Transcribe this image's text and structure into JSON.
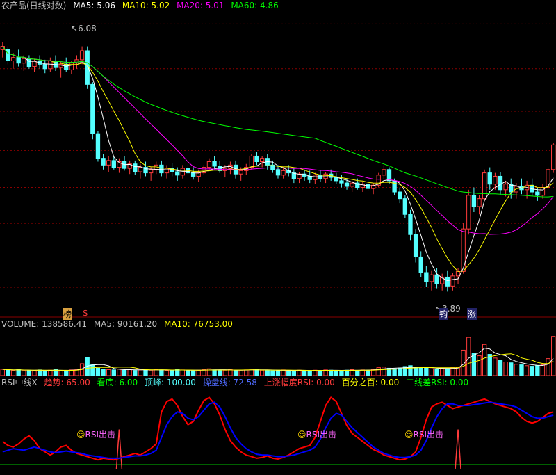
{
  "header": {
    "title": "农产品(日线对数)",
    "ma5": "MA5: 5.06",
    "ma10": "MA10: 5.02",
    "ma20": "MA20: 5.01",
    "ma60": "MA60: 4.86"
  },
  "volume_header": {
    "label": "VOLUME: 138586.41",
    "ma5": "MA5: 90161.20",
    "ma10": "MA10: 76753.00"
  },
  "rsi_header": {
    "name": "RSI中线X",
    "trend": "趋势: 65.00",
    "bottom": "看底: 6.00",
    "top": "顶峰: 100.00",
    "control": "操盘线: 72.58",
    "rise": "上涨幅度RSI: 0.00",
    "percent": "百分之百: 0.00",
    "diff": "二线差RSI: 0.00"
  },
  "annotations": {
    "high_price": "6.08",
    "low_price": "3.89",
    "marker_bang": "榜",
    "marker_s": "$",
    "marker_zhang": "涨",
    "marker_jun": "钧",
    "rsi_signal": "RSI出击"
  },
  "colors": {
    "up": "#ff3b3b",
    "down": "#54ffff",
    "ma5": "#ffffff",
    "ma10": "#ffff00",
    "ma20": "#ff00ff",
    "ma60": "#00ff00",
    "rsi_fast": "#ff0000",
    "rsi_slow": "#0000ff",
    "grid": "#8b0000",
    "signal": "#ff3b3b"
  },
  "chart_data": {
    "type": "candlestick",
    "price_range": [
      3.7,
      6.4
    ],
    "price_ticks": [
      6.28,
      5.88,
      5.5,
      5.15,
      4.82,
      4.5,
      4.2,
      3.93
    ],
    "ohlc": [
      [
        6.05,
        6.12,
        5.98,
        6.08
      ],
      [
        6.05,
        6.08,
        5.92,
        5.95
      ],
      [
        5.95,
        6.02,
        5.88,
        5.98
      ],
      [
        5.98,
        6.05,
        5.9,
        5.93
      ],
      [
        5.93,
        6.0,
        5.86,
        5.97
      ],
      [
        5.97,
        6.0,
        5.88,
        5.9
      ],
      [
        5.9,
        5.97,
        5.85,
        5.95
      ],
      [
        5.95,
        6.0,
        5.88,
        5.92
      ],
      [
        5.92,
        5.96,
        5.84,
        5.88
      ],
      [
        5.88,
        5.98,
        5.85,
        5.95
      ],
      [
        5.95,
        6.0,
        5.86,
        5.89
      ],
      [
        5.89,
        5.95,
        5.8,
        5.92
      ],
      [
        5.92,
        5.98,
        5.85,
        5.87
      ],
      [
        5.87,
        5.95,
        5.83,
        5.93
      ],
      [
        5.93,
        6.0,
        5.88,
        5.96
      ],
      [
        5.96,
        6.08,
        5.92,
        6.04
      ],
      [
        6.04,
        6.08,
        5.7,
        5.74
      ],
      [
        5.74,
        5.76,
        5.25,
        5.3
      ],
      [
        5.3,
        5.32,
        5.05,
        5.08
      ],
      [
        5.08,
        5.12,
        4.98,
        5.02
      ],
      [
        5.02,
        5.1,
        4.96,
        5.06
      ],
      [
        5.06,
        5.1,
        4.98,
        5.0
      ],
      [
        5.0,
        5.08,
        4.95,
        5.05
      ],
      [
        5.05,
        5.1,
        4.97,
        4.99
      ],
      [
        4.99,
        5.06,
        4.94,
        5.03
      ],
      [
        5.03,
        5.06,
        4.93,
        4.96
      ],
      [
        4.96,
        5.03,
        4.9,
        5.0
      ],
      [
        5.0,
        5.05,
        4.92,
        4.95
      ],
      [
        4.95,
        5.0,
        4.88,
        4.98
      ],
      [
        4.98,
        5.05,
        4.94,
        5.02
      ],
      [
        5.02,
        5.06,
        4.92,
        4.95
      ],
      [
        4.95,
        5.02,
        4.9,
        4.99
      ],
      [
        4.99,
        5.04,
        4.92,
        4.96
      ],
      [
        4.96,
        5.0,
        4.88,
        4.93
      ],
      [
        4.93,
        5.02,
        4.9,
        4.99
      ],
      [
        4.99,
        5.03,
        4.93,
        4.95
      ],
      [
        4.95,
        5.0,
        4.89,
        4.92
      ],
      [
        4.92,
        4.98,
        4.87,
        4.95
      ],
      [
        4.95,
        5.02,
        4.93,
        5.0
      ],
      [
        5.0,
        5.08,
        4.97,
        5.05
      ],
      [
        5.05,
        5.1,
        4.98,
        5.01
      ],
      [
        5.01,
        5.06,
        4.95,
        4.97
      ],
      [
        4.97,
        5.02,
        4.91,
        4.99
      ],
      [
        4.99,
        5.05,
        4.94,
        5.02
      ],
      [
        5.02,
        5.06,
        4.9,
        4.94
      ],
      [
        4.94,
        5.0,
        4.88,
        4.97
      ],
      [
        4.97,
        5.03,
        4.93,
        5.0
      ],
      [
        5.0,
        5.12,
        4.98,
        5.1
      ],
      [
        5.1,
        5.14,
        5.02,
        5.05
      ],
      [
        5.05,
        5.1,
        5.0,
        5.08
      ],
      [
        5.08,
        5.12,
        4.98,
        5.02
      ],
      [
        5.02,
        5.06,
        4.95,
        4.98
      ],
      [
        4.98,
        5.02,
        4.9,
        4.93
      ],
      [
        4.93,
        5.0,
        4.9,
        4.97
      ],
      [
        4.97,
        5.02,
        4.92,
        4.95
      ],
      [
        4.95,
        5.0,
        4.86,
        4.9
      ],
      [
        4.9,
        4.96,
        4.86,
        4.94
      ],
      [
        4.94,
        4.98,
        4.88,
        4.92
      ],
      [
        4.92,
        4.97,
        4.86,
        4.89
      ],
      [
        4.89,
        4.95,
        4.85,
        4.93
      ],
      [
        4.93,
        4.97,
        4.87,
        4.9
      ],
      [
        4.9,
        4.96,
        4.86,
        4.94
      ],
      [
        4.94,
        4.98,
        4.88,
        4.91
      ],
      [
        4.91,
        4.95,
        4.85,
        4.88
      ],
      [
        4.88,
        4.93,
        4.82,
        4.86
      ],
      [
        4.86,
        4.9,
        4.8,
        4.83
      ],
      [
        4.83,
        4.88,
        4.78,
        4.86
      ],
      [
        4.86,
        4.9,
        4.8,
        4.82
      ],
      [
        4.82,
        4.87,
        4.78,
        4.85
      ],
      [
        4.85,
        4.9,
        4.79,
        4.81
      ],
      [
        4.81,
        4.86,
        4.76,
        4.84
      ],
      [
        4.84,
        4.95,
        4.82,
        4.93
      ],
      [
        4.93,
        5.02,
        4.9,
        4.98
      ],
      [
        4.98,
        5.0,
        4.85,
        4.88
      ],
      [
        4.88,
        4.9,
        4.75,
        4.78
      ],
      [
        4.78,
        4.82,
        4.68,
        4.72
      ],
      [
        4.72,
        4.75,
        4.55,
        4.58
      ],
      [
        4.58,
        4.62,
        4.35,
        4.4
      ],
      [
        4.4,
        4.45,
        4.15,
        4.2
      ],
      [
        4.2,
        4.25,
        4.02,
        4.06
      ],
      [
        4.06,
        4.12,
        3.93,
        3.98
      ],
      [
        3.98,
        4.08,
        3.9,
        4.04
      ],
      [
        4.04,
        4.1,
        3.92,
        3.96
      ],
      [
        3.96,
        4.05,
        3.9,
        4.02
      ],
      [
        4.02,
        4.08,
        3.89,
        3.94
      ],
      [
        3.94,
        4.06,
        3.9,
        4.03
      ],
      [
        4.03,
        4.1,
        3.96,
        4.07
      ],
      [
        4.07,
        4.5,
        4.05,
        4.45
      ],
      [
        4.45,
        4.8,
        4.4,
        4.75
      ],
      [
        4.75,
        4.82,
        4.6,
        4.65
      ],
      [
        4.65,
        4.75,
        4.58,
        4.72
      ],
      [
        4.72,
        4.98,
        4.7,
        4.95
      ],
      [
        4.95,
        5.0,
        4.8,
        4.85
      ],
      [
        4.85,
        4.95,
        4.8,
        4.92
      ],
      [
        4.92,
        4.96,
        4.75,
        4.8
      ],
      [
        4.8,
        4.88,
        4.74,
        4.85
      ],
      [
        4.85,
        4.9,
        4.72,
        4.78
      ],
      [
        4.78,
        4.86,
        4.72,
        4.83
      ],
      [
        4.83,
        4.9,
        4.76,
        4.8
      ],
      [
        4.8,
        4.88,
        4.72,
        4.84
      ],
      [
        4.84,
        4.9,
        4.74,
        4.78
      ],
      [
        4.78,
        4.82,
        4.7,
        4.75
      ],
      [
        4.75,
        4.85,
        4.72,
        4.82
      ],
      [
        4.82,
        5.0,
        4.8,
        4.98
      ],
      [
        4.98,
        5.22,
        4.95,
        5.2
      ]
    ],
    "volume_range": [
      0,
      160000
    ],
    "volume": [
      22000,
      20000,
      18000,
      21000,
      17000,
      19000,
      18000,
      20000,
      16000,
      19000,
      21000,
      17000,
      18000,
      20000,
      22000,
      42000,
      65000,
      38000,
      26000,
      22000,
      21000,
      20000,
      23000,
      19000,
      21000,
      18000,
      20000,
      22000,
      19000,
      21000,
      20000,
      18000,
      19000,
      21000,
      20000,
      18000,
      17000,
      19000,
      22000,
      24000,
      20000,
      18000,
      19000,
      21000,
      18000,
      19000,
      20000,
      23000,
      21000,
      19000,
      18000,
      17000,
      19000,
      20000,
      18000,
      17000,
      19000,
      18000,
      17000,
      19000,
      18000,
      20000,
      19000,
      17000,
      18000,
      19000,
      21000,
      18000,
      20000,
      19000,
      22000,
      28000,
      30000,
      26000,
      24000,
      27000,
      32000,
      35000,
      30000,
      28000,
      26000,
      24000,
      23000,
      27000,
      25000,
      28000,
      30000,
      90000,
      135000,
      80000,
      70000,
      110000,
      75000,
      62000,
      55000,
      48000,
      45000,
      40000,
      38000,
      35000,
      33000,
      35000,
      38000,
      60000,
      138586
    ],
    "rsi_range": [
      0,
      100
    ],
    "rsi_fast": [
      35,
      30,
      28,
      32,
      38,
      42,
      36,
      26,
      22,
      18,
      22,
      28,
      30,
      24,
      20,
      18,
      16,
      14,
      12,
      14,
      13,
      12,
      14,
      16,
      18,
      20,
      18,
      22,
      26,
      32,
      72,
      85,
      88,
      80,
      66,
      56,
      60,
      74,
      86,
      90,
      82,
      68,
      50,
      36,
      28,
      22,
      18,
      16,
      14,
      15,
      17,
      14,
      13,
      15,
      18,
      22,
      26,
      28,
      30,
      40,
      60,
      80,
      90,
      85,
      70,
      55,
      45,
      40,
      35,
      30,
      25,
      22,
      18,
      16,
      14,
      12,
      13,
      16,
      22,
      40,
      62,
      78,
      82,
      84,
      80,
      76,
      78,
      80,
      82,
      84,
      86,
      88,
      85,
      82,
      80,
      78,
      76,
      72,
      65,
      60,
      58,
      60,
      65,
      70,
      72
    ],
    "rsi_slow": [
      22,
      24,
      26,
      25,
      24,
      26,
      28,
      26,
      24,
      22,
      21,
      22,
      23,
      22,
      21,
      20,
      18,
      17,
      16,
      15,
      14,
      14,
      14,
      15,
      16,
      17,
      17,
      18,
      20,
      24,
      40,
      56,
      66,
      72,
      70,
      64,
      62,
      66,
      74,
      82,
      84,
      78,
      66,
      52,
      40,
      32,
      26,
      22,
      19,
      18,
      18,
      17,
      16,
      16,
      17,
      18,
      20,
      22,
      24,
      28,
      38,
      52,
      64,
      70,
      68,
      60,
      52,
      46,
      40,
      34,
      28,
      24,
      20,
      18,
      16,
      15,
      15,
      16,
      18,
      24,
      36,
      52,
      66,
      76,
      82,
      82,
      80,
      80,
      80,
      81,
      82,
      83,
      84,
      83,
      82,
      81,
      80,
      78,
      74,
      70,
      66,
      64,
      64,
      66,
      68
    ],
    "rsi_signal_bars": [
      22,
      86,
      124
    ],
    "rsi_green_bars": [
      115,
      117,
      118,
      120
    ]
  }
}
